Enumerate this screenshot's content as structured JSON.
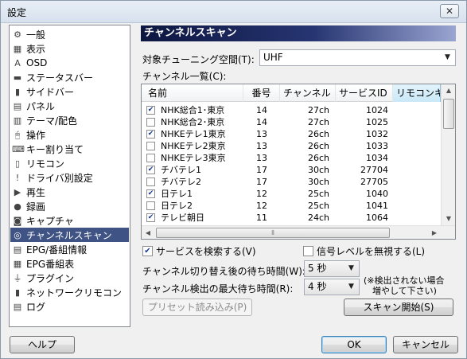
{
  "window": {
    "title": "設定",
    "close_glyph": "✕"
  },
  "sidebar": {
    "items": [
      {
        "label": "一般",
        "icon": "⚙",
        "icon_name": "gear-icon"
      },
      {
        "label": "表示",
        "icon": "▦",
        "icon_name": "display-icon"
      },
      {
        "label": "OSD",
        "icon": "A",
        "icon_name": "osd-icon"
      },
      {
        "label": "ステータスバー",
        "icon": "▬",
        "icon_name": "statusbar-icon"
      },
      {
        "label": "サイドバー",
        "icon": "▮",
        "icon_name": "sidebar-panel-icon"
      },
      {
        "label": "パネル",
        "icon": "▤",
        "icon_name": "panel-icon"
      },
      {
        "label": "テーマ/配色",
        "icon": "▥",
        "icon_name": "theme-icon"
      },
      {
        "label": "操作",
        "icon": "🖰",
        "icon_name": "mouse-icon"
      },
      {
        "label": "キー割り当て",
        "icon": "⌨",
        "icon_name": "keyboard-icon"
      },
      {
        "label": "リモコン",
        "icon": "▯",
        "icon_name": "remote-icon"
      },
      {
        "label": "ドライバ別設定",
        "icon": "!",
        "icon_name": "driver-icon"
      },
      {
        "label": "再生",
        "icon": "▶",
        "icon_name": "play-icon"
      },
      {
        "label": "録画",
        "icon": "●",
        "icon_name": "record-icon"
      },
      {
        "label": "キャプチャ",
        "icon": "◙",
        "icon_name": "camera-icon"
      },
      {
        "label": "チャンネルスキャン",
        "icon": "◎",
        "icon_name": "scan-icon"
      },
      {
        "label": "EPG/番組情報",
        "icon": "▤",
        "icon_name": "epg-icon"
      },
      {
        "label": "EPG番組表",
        "icon": "▦",
        "icon_name": "program-guide-icon"
      },
      {
        "label": "プラグイン",
        "icon": "⏚",
        "icon_name": "plugin-icon"
      },
      {
        "label": "ネットワークリモコン",
        "icon": "▮",
        "icon_name": "network-remote-icon"
      },
      {
        "label": "ログ",
        "icon": "▤",
        "icon_name": "log-icon"
      }
    ],
    "selected_index": 14
  },
  "panel": {
    "title": "チャンネルスキャン",
    "tuning_space_label": "対象チューニング空間(T):",
    "tuning_space_value": "UHF",
    "channel_list_label": "チャンネル一覧(C):",
    "columns": [
      "名前",
      "番号",
      "チャンネル",
      "サービスID",
      "リモコンキ"
    ],
    "rows": [
      {
        "checked": true,
        "name": "NHK総合1･東京",
        "number": "14",
        "channel": "27ch",
        "service_id": "1024"
      },
      {
        "checked": false,
        "name": "NHK総合2･東京",
        "number": "14",
        "channel": "27ch",
        "service_id": "1025"
      },
      {
        "checked": true,
        "name": "NHKEテレ1東京",
        "number": "13",
        "channel": "26ch",
        "service_id": "1032"
      },
      {
        "checked": false,
        "name": "NHKEテレ2東京",
        "number": "13",
        "channel": "26ch",
        "service_id": "1033"
      },
      {
        "checked": false,
        "name": "NHKEテレ3東京",
        "number": "13",
        "channel": "26ch",
        "service_id": "1034"
      },
      {
        "checked": true,
        "name": "チバテレ1",
        "number": "17",
        "channel": "30ch",
        "service_id": "27704"
      },
      {
        "checked": false,
        "name": "チバテレ2",
        "number": "17",
        "channel": "30ch",
        "service_id": "27705"
      },
      {
        "checked": true,
        "name": "日テレ1",
        "number": "12",
        "channel": "25ch",
        "service_id": "1040"
      },
      {
        "checked": false,
        "name": "日テレ2",
        "number": "12",
        "channel": "25ch",
        "service_id": "1041"
      },
      {
        "checked": true,
        "name": "テレビ朝日",
        "number": "11",
        "channel": "24ch",
        "service_id": "1064"
      }
    ],
    "search_services_label": "サービスを検索する(V)",
    "search_services_checked": true,
    "ignore_signal_label": "信号レベルを無視する(L)",
    "ignore_signal_checked": false,
    "wait_after_switch_label": "チャンネル切り替え後の待ち時間(W):",
    "wait_after_switch_value": "5 秒",
    "max_wait_label": "チャンネル検出の最大待ち時間(R):",
    "max_wait_value": "4 秒",
    "max_wait_note_line1": "(※検出されない場合",
    "max_wait_note_line2": "増やして下さい)",
    "preset_button": "プリセット読み込み(P)",
    "scan_button": "スキャン開始(S)"
  },
  "footer": {
    "help_button": "ヘルプ",
    "ok_button": "OK",
    "cancel_button": "キャンセル"
  },
  "colors": {
    "selection": "#3f5384",
    "title_band_start": "#0c1640",
    "title_band_end": "#9aa5d1"
  }
}
